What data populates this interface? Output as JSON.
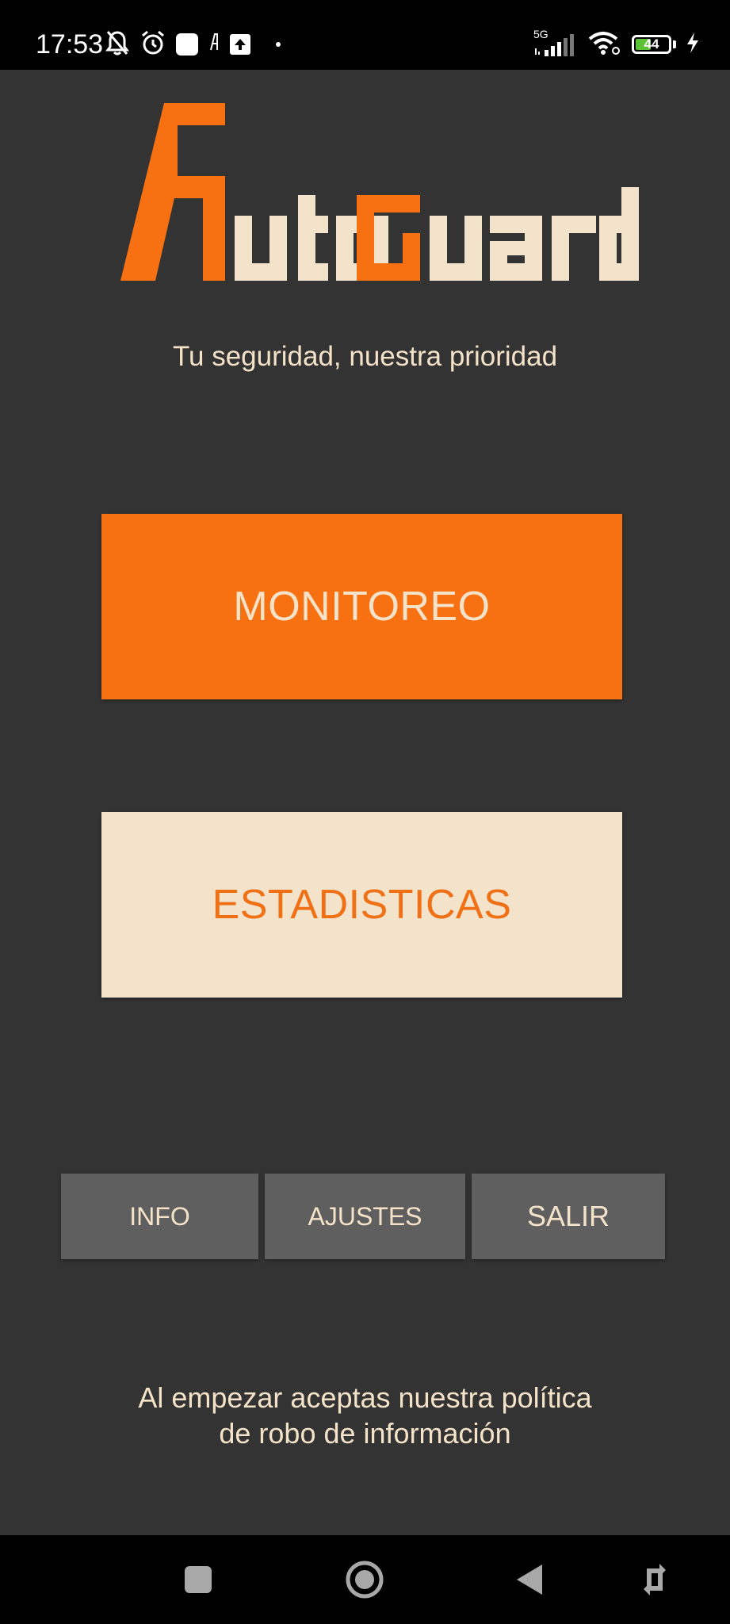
{
  "status_bar": {
    "time": "17:53",
    "network": "5G",
    "battery_level": "44",
    "left_icons": [
      "bell-off-icon",
      "alarm-icon",
      "app-square-icon",
      "font-glyph-icon",
      "upload-icon",
      "dot-icon"
    ],
    "right_icons": [
      "signal-icon",
      "wifi-icon",
      "battery-icon",
      "charging-icon"
    ]
  },
  "logo": {
    "text_initial": "A",
    "text_part1": "uto",
    "text_initial2": "G",
    "text_part2": "uard"
  },
  "tagline": "Tu seguridad, nuestra prioridad",
  "main_buttons": {
    "monitoreo": "MONITOREO",
    "estadisticas": "ESTADISTICAS"
  },
  "bottom_buttons": {
    "info": "INFO",
    "ajustes": "AJUSTES",
    "salir": "SALIR"
  },
  "footer": {
    "line1": "Al empezar aceptas nuestra política",
    "line2": "de robo de información"
  },
  "nav_bar": [
    "recents-icon",
    "home-icon",
    "back-icon",
    "rotate-icon"
  ],
  "colors": {
    "background": "#333333",
    "accent_orange": "#f77011",
    "cream": "#f4e3cb",
    "secondary_button": "#5f5f5f"
  }
}
